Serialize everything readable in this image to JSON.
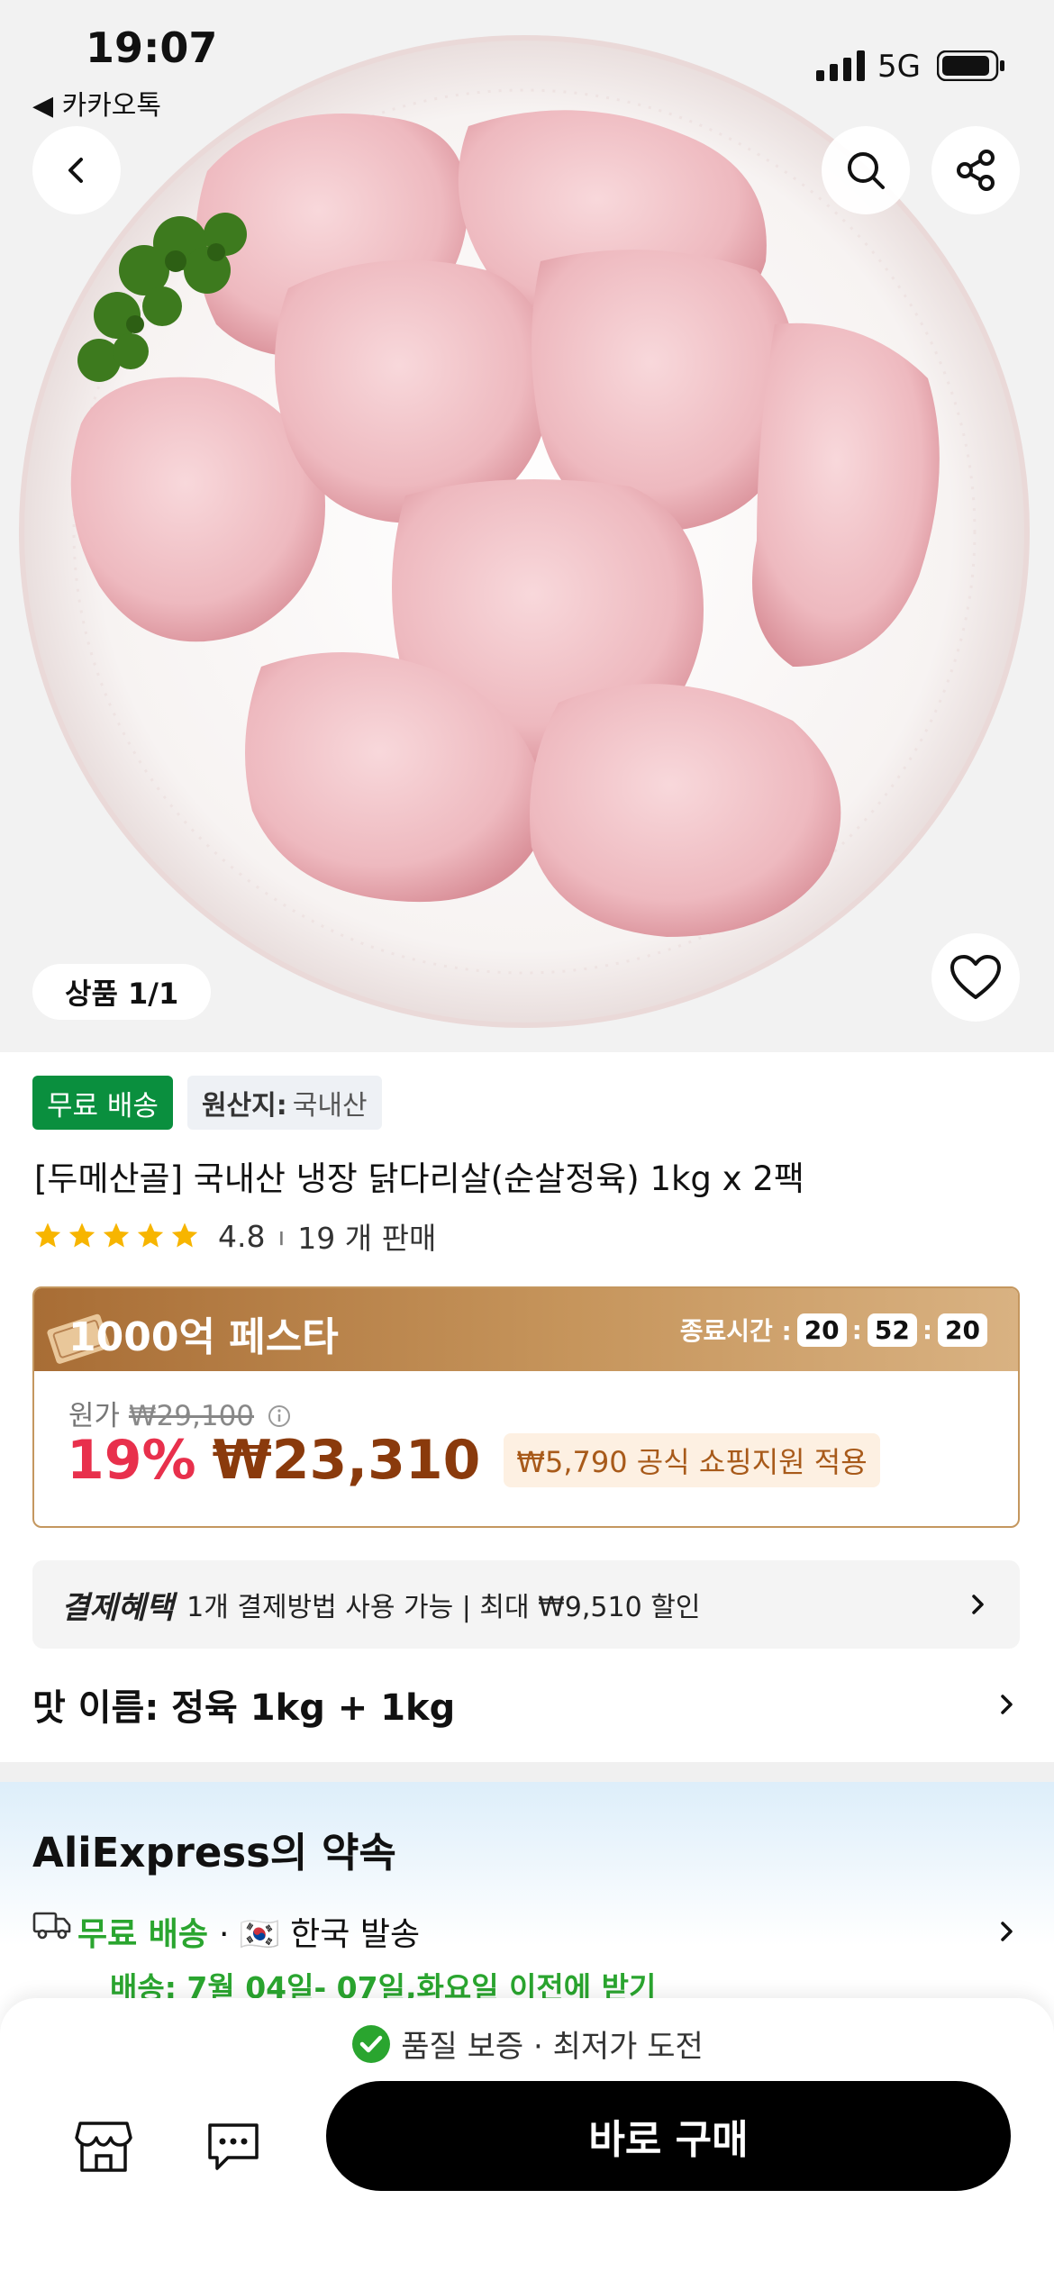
{
  "status_bar": {
    "time": "19:07",
    "back_app": "◀ 카카오톡",
    "network": "5G"
  },
  "gallery": {
    "counter": "상품 1/1"
  },
  "badges": {
    "free_shipping": "무료 배송",
    "origin_label": "원산지:",
    "origin_value": "국내산"
  },
  "product": {
    "title": "[두메산골] 국내산 냉장 닭다리살(순살정육) 1kg x 2팩",
    "rating": "4.8",
    "sold": "19 개 판매",
    "star_count": 5
  },
  "promo": {
    "title": "1000억 페스타",
    "timer_label": "종료시간 :",
    "timer": [
      "20",
      "52",
      "20"
    ],
    "original_label": "원가",
    "original_price": "₩29,100",
    "discount": "19%",
    "price": "₩23,310",
    "subsidy": "₩5,790 공식 쇼핑지원 적용"
  },
  "payment": {
    "title": "결제혜택",
    "text": "1개 결제방법 사용 가능 | 최대 ₩9,510 할인"
  },
  "option": {
    "text": "맛 이름: 정육 1kg + 1kg"
  },
  "promise": {
    "title": "AliExpress의 약속",
    "free_shipping": "무료 배송",
    "ship_from": "· 🇰🇷 한국 발송",
    "delivery": "배송: 7월 04일- 07일,화요일 이전에 받기"
  },
  "bottom_bar": {
    "guarantee": "품질 보증 · 최저가 도전",
    "buy_label": "바로 구매"
  },
  "colors": {
    "accent_green": "#0a8f3e",
    "discount_red": "#e8304c",
    "price_brown": "#8a3a0c",
    "fest_gold": "#c4975f"
  }
}
